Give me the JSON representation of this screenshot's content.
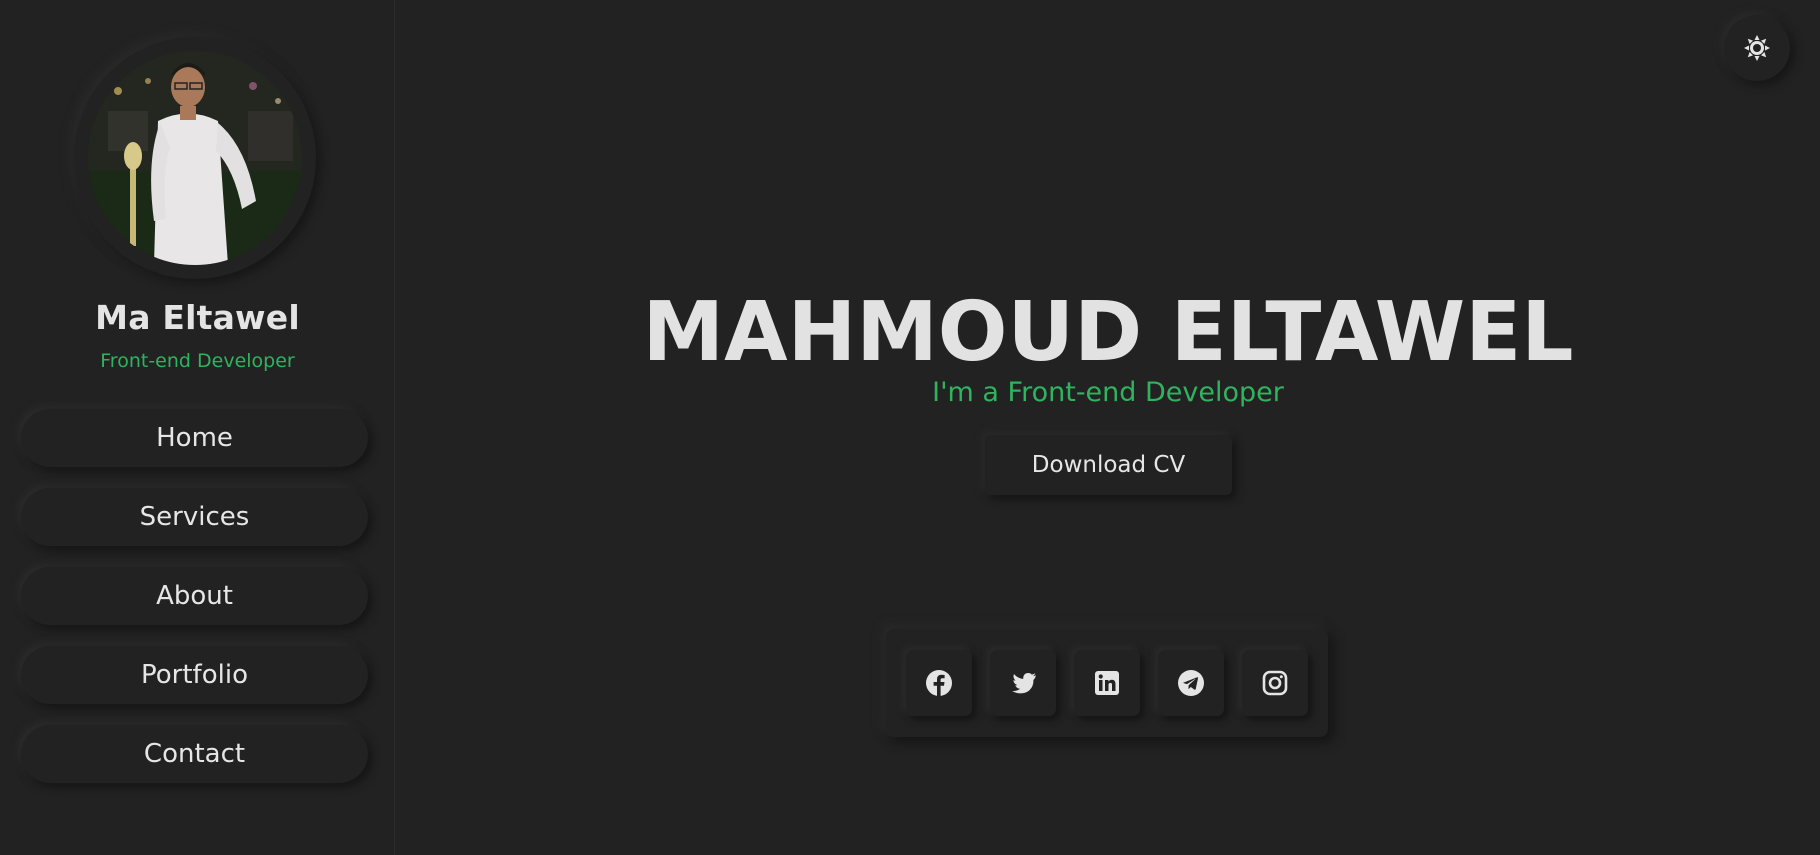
{
  "sidebar": {
    "profile": {
      "name": "Ma Eltawel",
      "role": "Front-end Developer",
      "avatar_icon": "profile-photo"
    },
    "nav": [
      {
        "label": "Home"
      },
      {
        "label": "Services"
      },
      {
        "label": "About"
      },
      {
        "label": "Portfolio"
      },
      {
        "label": "Contact"
      }
    ]
  },
  "main": {
    "theme_toggle_icon": "sun-icon",
    "hero": {
      "title": "MAHMOUD ELTAWEL",
      "subtitle": "I'm a Front-end Developer",
      "cv_button": "Download CV"
    },
    "social": [
      {
        "name": "Facebook",
        "icon": "facebook-icon"
      },
      {
        "name": "Twitter",
        "icon": "twitter-icon"
      },
      {
        "name": "LinkedIn",
        "icon": "linkedin-icon"
      },
      {
        "name": "Telegram",
        "icon": "telegram-icon"
      },
      {
        "name": "Instagram",
        "icon": "instagram-icon"
      }
    ]
  },
  "colors": {
    "background": "#222222",
    "accent": "#2fb35f",
    "text": "#e2e2e2"
  }
}
